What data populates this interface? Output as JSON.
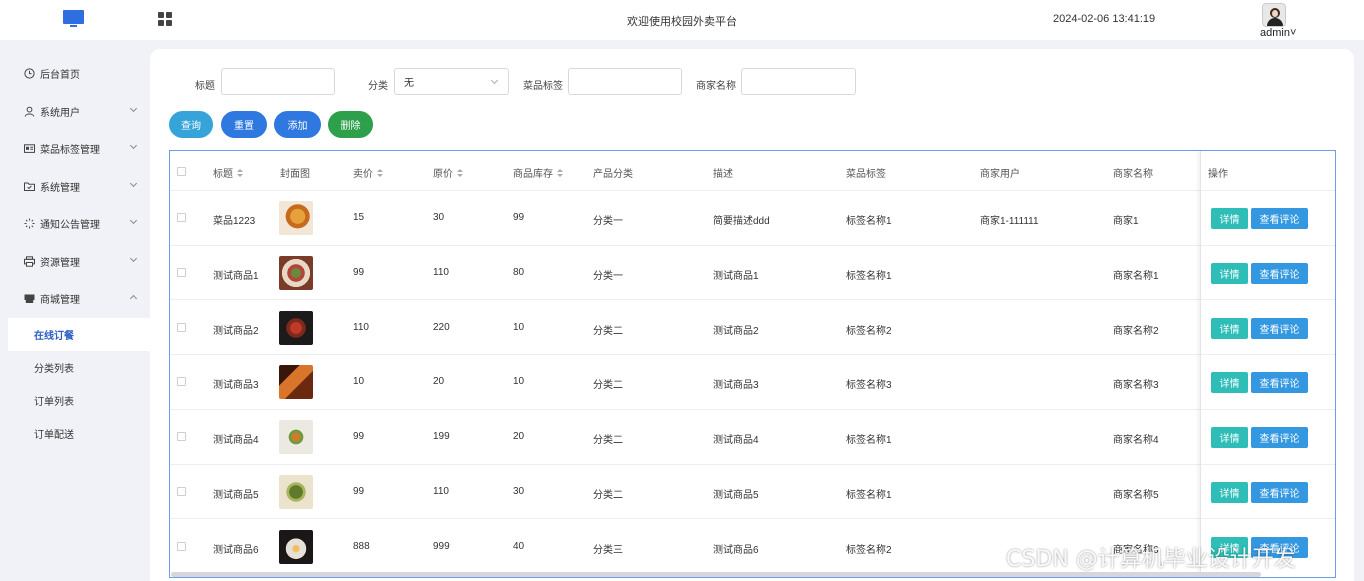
{
  "header": {
    "site_title": "欢迎使用校园外卖平台",
    "datetime": "2024-02-06 13:41:19",
    "user_name": "admin˅"
  },
  "sidebar": {
    "items": [
      {
        "label": "后台首页",
        "icon": "clock-icon"
      },
      {
        "label": "系统用户",
        "icon": "user-icon"
      },
      {
        "label": "菜品标签管理",
        "icon": "id-card-icon"
      },
      {
        "label": "系统管理",
        "icon": "folder-icon"
      },
      {
        "label": "通知公告管理",
        "icon": "loading-icon"
      },
      {
        "label": "资源管理",
        "icon": "printer-icon"
      },
      {
        "label": "商城管理",
        "icon": "shop-icon"
      }
    ],
    "sub_items": [
      {
        "label": "在线订餐",
        "active": true
      },
      {
        "label": "分类列表",
        "active": false
      },
      {
        "label": "订单列表",
        "active": false
      },
      {
        "label": "订单配送",
        "active": false
      }
    ]
  },
  "filters": {
    "title_label": "标题",
    "title_value": "",
    "category_label": "分类",
    "category_value": "无",
    "tag_label": "菜品标签",
    "tag_value": "",
    "merchant_label": "商家名称",
    "merchant_value": ""
  },
  "actions": {
    "query": "查询",
    "reset": "重置",
    "add": "添加",
    "delete": "删除"
  },
  "colors": {
    "query": "#37a4d9",
    "reset": "#2f78e0",
    "add": "#2f78e0",
    "delete": "#2e9f4b",
    "detail": "#2ebeb7",
    "comments": "#3498e0"
  },
  "table": {
    "headers": {
      "title": "标题",
      "cover": "封面图",
      "price": "卖价",
      "original_price": "原价",
      "stock": "商品库存",
      "category": "产品分类",
      "description": "描述",
      "tag": "菜品标签",
      "merchant_user": "商家用户",
      "merchant_name": "商家名称",
      "ops": "操作"
    },
    "detail_label": "详情",
    "comments_label": "查看评论",
    "rows": [
      {
        "title": "菜品1223",
        "price": "15",
        "original_price": "30",
        "stock": "99",
        "category": "分类一",
        "description": "简要描述ddd",
        "tag": "标签名称1",
        "merchant_user": "商家1-111111",
        "merchant_name": "商家1"
      },
      {
        "title": "测试商品1",
        "price": "99",
        "original_price": "110",
        "stock": "80",
        "category": "分类一",
        "description": "测试商品1",
        "tag": "标签名称1",
        "merchant_user": "",
        "merchant_name": "商家名称1"
      },
      {
        "title": "测试商品2",
        "price": "110",
        "original_price": "220",
        "stock": "10",
        "category": "分类二",
        "description": "测试商品2",
        "tag": "标签名称2",
        "merchant_user": "",
        "merchant_name": "商家名称2"
      },
      {
        "title": "测试商品3",
        "price": "10",
        "original_price": "20",
        "stock": "10",
        "category": "分类二",
        "description": "测试商品3",
        "tag": "标签名称3",
        "merchant_user": "",
        "merchant_name": "商家名称3"
      },
      {
        "title": "测试商品4",
        "price": "99",
        "original_price": "199",
        "stock": "20",
        "category": "分类二",
        "description": "测试商品4",
        "tag": "标签名称1",
        "merchant_user": "",
        "merchant_name": "商家名称4"
      },
      {
        "title": "测试商品5",
        "price": "99",
        "original_price": "110",
        "stock": "30",
        "category": "分类二",
        "description": "测试商品5",
        "tag": "标签名称1",
        "merchant_user": "",
        "merchant_name": "商家名称5"
      },
      {
        "title": "测试商品6",
        "price": "888",
        "original_price": "999",
        "stock": "40",
        "category": "分类三",
        "description": "测试商品6",
        "tag": "标签名称2",
        "merchant_user": "",
        "merchant_name": "商家名称6"
      }
    ]
  },
  "watermark": "CSDN @计算机毕业设计开发"
}
